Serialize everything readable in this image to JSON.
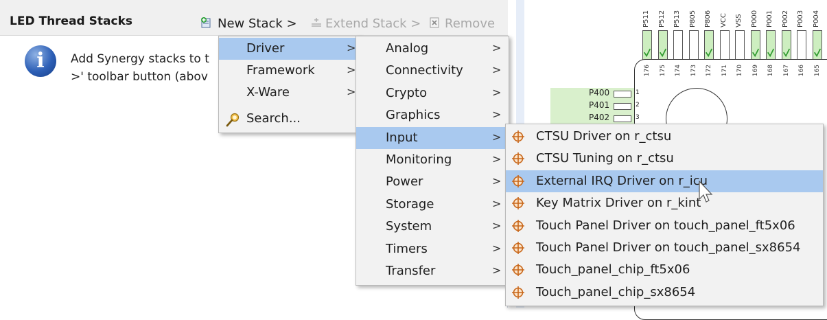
{
  "panel": {
    "title": "LED Thread Stacks",
    "toolbar": {
      "new_stack": "New Stack >",
      "extend_stack": "Extend Stack >",
      "remove": "Remove"
    },
    "info_lines": [
      "Add Synergy stacks to t",
      ">' toolbar button (abov"
    ]
  },
  "menu_level1": {
    "items": [
      {
        "label": "Driver",
        "has_submenu": true,
        "highlighted": true
      },
      {
        "label": "Framework",
        "has_submenu": true,
        "highlighted": false
      },
      {
        "label": "X-Ware",
        "has_submenu": true,
        "highlighted": false
      },
      {
        "label": "Search...",
        "has_submenu": false,
        "highlighted": false
      }
    ]
  },
  "menu_level2": {
    "items": [
      {
        "label": "Analog",
        "highlighted": false
      },
      {
        "label": "Connectivity",
        "highlighted": false
      },
      {
        "label": "Crypto",
        "highlighted": false
      },
      {
        "label": "Graphics",
        "highlighted": false
      },
      {
        "label": "Input",
        "highlighted": true
      },
      {
        "label": "Monitoring",
        "highlighted": false
      },
      {
        "label": "Power",
        "highlighted": false
      },
      {
        "label": "Storage",
        "highlighted": false
      },
      {
        "label": "System",
        "highlighted": false
      },
      {
        "label": "Timers",
        "highlighted": false
      },
      {
        "label": "Transfer",
        "highlighted": false
      }
    ]
  },
  "menu_level3": {
    "items": [
      {
        "label": "CTSU Driver on r_ctsu",
        "highlighted": false
      },
      {
        "label": "CTSU Tuning on r_ctsu",
        "highlighted": false
      },
      {
        "label": "External IRQ Driver on r_icu",
        "highlighted": true
      },
      {
        "label": "Key Matrix Driver on r_kint",
        "highlighted": false
      },
      {
        "label": "Touch Panel Driver on touch_panel_ft5x06",
        "highlighted": false
      },
      {
        "label": "Touch Panel Driver on touch_panel_sx8654",
        "highlighted": false
      },
      {
        "label": "Touch_panel_chip_ft5x06",
        "highlighted": false
      },
      {
        "label": "Touch_panel_chip_sx8654",
        "highlighted": false
      }
    ]
  },
  "chip": {
    "top_pins": [
      {
        "label": "P511",
        "num": "176",
        "checked": true
      },
      {
        "label": "P512",
        "num": "175",
        "checked": true
      },
      {
        "label": "P513",
        "num": "174",
        "checked": false
      },
      {
        "label": "P805",
        "num": "173",
        "checked": false
      },
      {
        "label": "P806",
        "num": "172",
        "checked": true
      },
      {
        "label": "VCC",
        "num": "171",
        "checked": false
      },
      {
        "label": "VSS",
        "num": "170",
        "checked": false
      },
      {
        "label": "P000",
        "num": "169",
        "checked": true
      },
      {
        "label": "P001",
        "num": "168",
        "checked": true
      },
      {
        "label": "P002",
        "num": "167",
        "checked": true
      },
      {
        "label": "P003",
        "num": "166",
        "checked": false
      },
      {
        "label": "P004",
        "num": "165",
        "checked": true
      }
    ],
    "side_pins": [
      {
        "label": "P400",
        "num": "1"
      },
      {
        "label": "P401",
        "num": "2"
      },
      {
        "label": "P402",
        "num": "3"
      }
    ]
  },
  "colors": {
    "highlight": "#a9c9ef",
    "menu_bg": "#f2f2f2",
    "pin_green": "#cdeec0",
    "check_green": "#2f9a2f",
    "icon_orange": "#c8671a"
  }
}
